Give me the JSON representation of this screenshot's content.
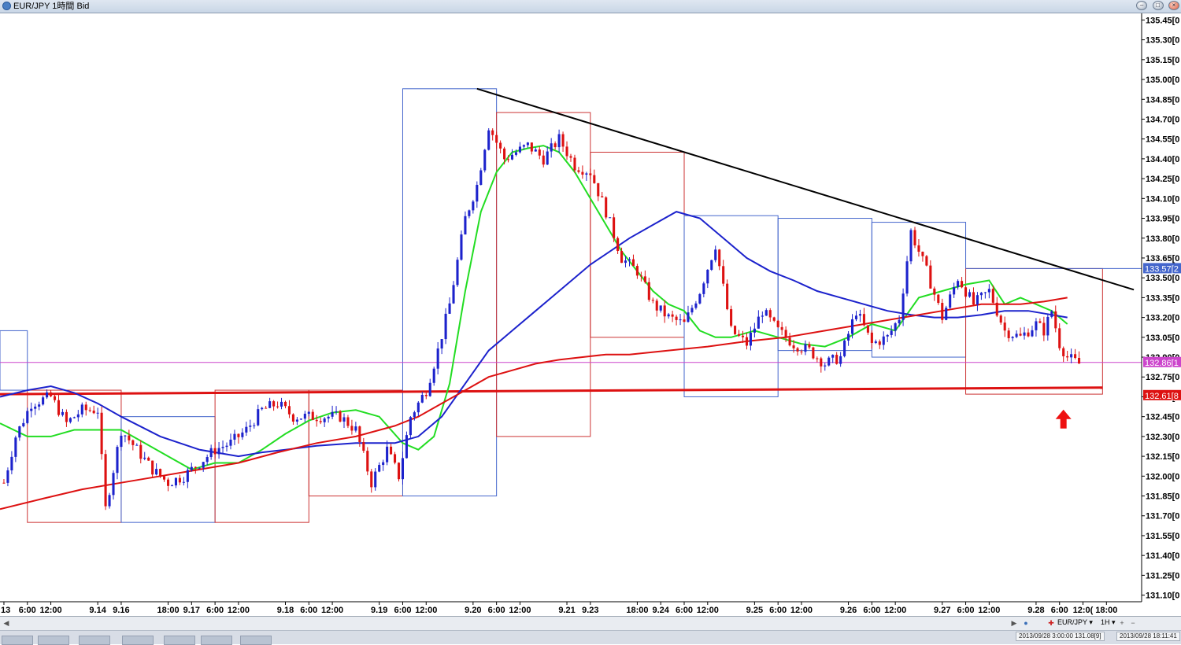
{
  "window": {
    "title": "EUR/JPY 1時間 Bid"
  },
  "toolbar": {
    "symbol": "EUR/JPY",
    "timeframe": "1H"
  },
  "status": {
    "left": "2013/09/28 3:00:00 131.08[9]",
    "right": "2013/09/28 18:11:41"
  },
  "colors": {
    "ma_green": "#22dd22",
    "ma_blue": "#1c22cc",
    "ma_red": "#dd1111",
    "up_candle": "#1c22cc",
    "down_candle": "#dd1111",
    "trendline": "#000000",
    "support": "#dd1111",
    "bid_line": "#cc44cc",
    "box_blue": "#4466cc",
    "box_red": "#cc3333",
    "arrow": "#ee1111"
  },
  "chart_data": {
    "type": "candlestick",
    "title": "EUR/JPY 1時間 Bid",
    "ylim": [
      131.05,
      135.5
    ],
    "y_ticks": [
      "135.45[0",
      "135.30[0",
      "135.15[0",
      "135.00[0",
      "134.85[0",
      "134.70[0",
      "134.55[0",
      "134.40[0",
      "134.25[0",
      "134.10[0",
      "133.95[0",
      "133.80[0",
      "133.65[0",
      "133.50[0",
      "133.35[0",
      "133.20[0",
      "133.05[0",
      "132.90[0",
      "132.75[0",
      "132.60[0",
      "132.45[0",
      "132.30[0",
      "132.15[0",
      "132.00[0",
      "131.85[0",
      "131.70[0",
      "131.55[0",
      "131.40[0",
      "131.25[0",
      "131.10[0"
    ],
    "price_markers": [
      {
        "label": "133.57[2",
        "value": 133.57,
        "color": "#4466cc"
      },
      {
        "label": "132.86[1",
        "value": 132.86,
        "color": "#cc44cc"
      },
      {
        "label": "132.61[8",
        "value": 132.61,
        "color": "#dd1111"
      }
    ],
    "x_ticks": [
      "13",
      "6:00",
      "12:00",
      "9.14",
      "9.16",
      "18:00",
      "9.17",
      "6:00",
      "12:00",
      "9.18",
      "6:00",
      "12:00",
      "9.19",
      "6:00",
      "12:00",
      "9.20",
      "6:00",
      "12:00",
      "9.21",
      "9.23",
      "18:00",
      "9.24",
      "6:00",
      "12:00",
      "9.25",
      "6:00",
      "12:00",
      "9.26",
      "6:00",
      "12:00",
      "9.27",
      "6:00",
      "12:00",
      "9.28",
      "6:00",
      "12:0(",
      "18:00"
    ],
    "x_tick_values": [
      0,
      6,
      12,
      24,
      30,
      42,
      48,
      54,
      60,
      72,
      78,
      84,
      96,
      102,
      108,
      120,
      126,
      132,
      144,
      150,
      162,
      168,
      174,
      180,
      192,
      198,
      204,
      216,
      222,
      228,
      240,
      246,
      252,
      264,
      270,
      276,
      282
    ],
    "x_range": [
      -1,
      291
    ],
    "trendline": {
      "x": [
        121,
        289
      ],
      "y": [
        134.93,
        133.41
      ]
    },
    "support_line": {
      "x": [
        -1,
        281
      ],
      "y": [
        132.62,
        132.67
      ]
    },
    "bid_line": 132.86,
    "ohlc_anchors": {
      "x": [
        0,
        3,
        7,
        12,
        16,
        20,
        24,
        26,
        30,
        34,
        38,
        42,
        46,
        50,
        54,
        58,
        62,
        66,
        70,
        74,
        78,
        82,
        86,
        90,
        94,
        98,
        101,
        104,
        108,
        111,
        114,
        118,
        121,
        124,
        128,
        134,
        138,
        142,
        146,
        150,
        154,
        158,
        162,
        166,
        170,
        174,
        178,
        182,
        186,
        190,
        194,
        198,
        202,
        206,
        210,
        214,
        218,
        222,
        226,
        229,
        232,
        236,
        240,
        244,
        248,
        252,
        256,
        260,
        264,
        266,
        268,
        270,
        272,
        275
      ],
      "y": [
        131.95,
        132.3,
        132.55,
        132.6,
        132.4,
        132.5,
        132.5,
        131.75,
        132.35,
        132.2,
        132.05,
        131.95,
        132.0,
        132.1,
        132.2,
        132.25,
        132.35,
        132.5,
        132.55,
        132.45,
        132.45,
        132.45,
        132.45,
        132.35,
        131.95,
        132.2,
        132.0,
        132.45,
        132.65,
        132.95,
        133.3,
        133.95,
        134.2,
        134.65,
        134.4,
        134.5,
        134.4,
        134.55,
        134.35,
        134.3,
        134.0,
        133.65,
        133.55,
        133.3,
        133.2,
        133.15,
        133.4,
        133.75,
        133.1,
        133.0,
        133.25,
        133.1,
        133.0,
        132.95,
        132.85,
        132.9,
        133.25,
        133.0,
        133.05,
        133.2,
        133.85,
        133.55,
        133.2,
        133.5,
        133.3,
        133.4,
        133.1,
        133.05,
        133.15,
        133.1,
        133.25,
        133.0,
        132.9,
        132.85
      ]
    },
    "moving_averages": [
      {
        "color": "#22dd22",
        "x": [
          -1,
          6,
          12,
          18,
          24,
          30,
          36,
          42,
          48,
          54,
          60,
          66,
          72,
          78,
          84,
          90,
          96,
          102,
          106,
          110,
          114,
          118,
          122,
          126,
          130,
          134,
          138,
          142,
          146,
          150,
          154,
          158,
          162,
          166,
          170,
          174,
          178,
          182,
          186,
          192,
          198,
          204,
          210,
          216,
          222,
          228,
          234,
          240,
          246,
          252,
          256,
          260,
          264,
          268,
          272
        ],
        "y": [
          132.4,
          132.3,
          132.3,
          132.35,
          132.35,
          132.35,
          132.25,
          132.15,
          132.05,
          132.1,
          132.1,
          132.2,
          132.32,
          132.42,
          132.48,
          132.5,
          132.45,
          132.25,
          132.2,
          132.3,
          132.7,
          133.4,
          134.0,
          134.3,
          134.45,
          134.48,
          134.5,
          134.45,
          134.3,
          134.1,
          133.9,
          133.7,
          133.55,
          133.4,
          133.3,
          133.25,
          133.1,
          133.05,
          133.05,
          133.1,
          133.05,
          133.0,
          132.98,
          133.05,
          133.15,
          133.1,
          133.35,
          133.4,
          133.45,
          133.48,
          133.3,
          133.35,
          133.3,
          133.25,
          133.15
        ]
      },
      {
        "color": "#1c22cc",
        "x": [
          -1,
          6,
          12,
          18,
          24,
          30,
          40,
          50,
          60,
          66,
          72,
          80,
          90,
          100,
          106,
          112,
          118,
          124,
          130,
          136,
          142,
          150,
          160,
          166,
          172,
          178,
          184,
          190,
          196,
          202,
          208,
          214,
          220,
          226,
          232,
          238,
          244,
          250,
          256,
          262,
          268,
          272
        ],
        "y": [
          132.6,
          132.65,
          132.68,
          132.63,
          132.55,
          132.45,
          132.3,
          132.2,
          132.15,
          132.18,
          132.2,
          132.23,
          132.25,
          132.25,
          132.3,
          132.45,
          132.7,
          132.95,
          133.1,
          133.25,
          133.4,
          133.6,
          133.8,
          133.9,
          134.0,
          133.95,
          133.8,
          133.65,
          133.55,
          133.48,
          133.4,
          133.35,
          133.3,
          133.25,
          133.22,
          133.2,
          133.2,
          133.22,
          133.25,
          133.25,
          133.22,
          133.2
        ]
      },
      {
        "color": "#dd1111",
        "x": [
          -1,
          10,
          20,
          30,
          40,
          50,
          60,
          70,
          80,
          90,
          100,
          106,
          112,
          118,
          124,
          130,
          136,
          142,
          148,
          154,
          160,
          170,
          180,
          190,
          200,
          210,
          220,
          230,
          240,
          250,
          260,
          266,
          272
        ],
        "y": [
          131.75,
          131.83,
          131.9,
          131.95,
          132.0,
          132.05,
          132.1,
          132.18,
          132.25,
          132.3,
          132.38,
          132.45,
          132.55,
          132.65,
          132.75,
          132.8,
          132.85,
          132.88,
          132.9,
          132.92,
          132.92,
          132.95,
          132.98,
          133.02,
          133.05,
          133.1,
          133.15,
          133.2,
          133.25,
          133.3,
          133.3,
          133.32,
          133.35
        ]
      }
    ],
    "session_boxes": [
      {
        "x0": -1,
        "x1": 6,
        "hi": 133.1,
        "lo": 132.65,
        "dir": "up"
      },
      {
        "x0": 6,
        "x1": 30,
        "hi": 132.65,
        "lo": 131.65,
        "dir": "down"
      },
      {
        "x0": 30,
        "x1": 54,
        "hi": 132.45,
        "lo": 131.65,
        "dir": "up"
      },
      {
        "x0": 54,
        "x1": 78,
        "hi": 132.65,
        "lo": 131.65,
        "dir": "down"
      },
      {
        "x0": 78,
        "x1": 102,
        "hi": 132.65,
        "lo": 131.85,
        "dir": "down"
      },
      {
        "x0": 102,
        "x1": 126,
        "hi": 134.93,
        "lo": 131.85,
        "dir": "up"
      },
      {
        "x0": 126,
        "x1": 150,
        "hi": 134.75,
        "lo": 132.3,
        "dir": "down"
      },
      {
        "x0": 150,
        "x1": 174,
        "hi": 134.45,
        "lo": 133.05,
        "dir": "down"
      },
      {
        "x0": 174,
        "x1": 198,
        "hi": 133.97,
        "lo": 132.6,
        "dir": "up"
      },
      {
        "x0": 198,
        "x1": 222,
        "hi": 133.95,
        "lo": 132.95,
        "dir": "up"
      },
      {
        "x0": 222,
        "x1": 246,
        "hi": 133.92,
        "lo": 132.9,
        "dir": "up"
      },
      {
        "x0": 246,
        "x1": 281,
        "hi": 133.57,
        "lo": 132.62,
        "dir": "down"
      }
    ],
    "arrow": {
      "x": 271,
      "y": 132.42
    }
  }
}
